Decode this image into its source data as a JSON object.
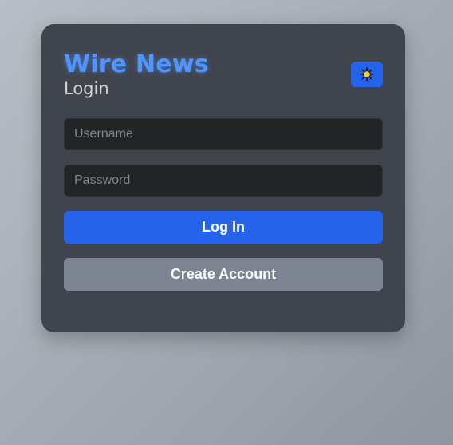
{
  "app": {
    "brand": "Wire News",
    "subtitle": "Login"
  },
  "theme_toggle": {
    "icon": "sun-icon",
    "icon_color": "#ffd21f",
    "background": "#2563eb"
  },
  "form": {
    "username": {
      "placeholder": "Username",
      "value": ""
    },
    "password": {
      "placeholder": "Password",
      "value": ""
    },
    "login_label": "Log In",
    "create_label": "Create Account"
  },
  "colors": {
    "accent": "#2563eb",
    "brand": "#4f94ff",
    "card": "#40444c",
    "secondary_button": "#7c8591"
  }
}
